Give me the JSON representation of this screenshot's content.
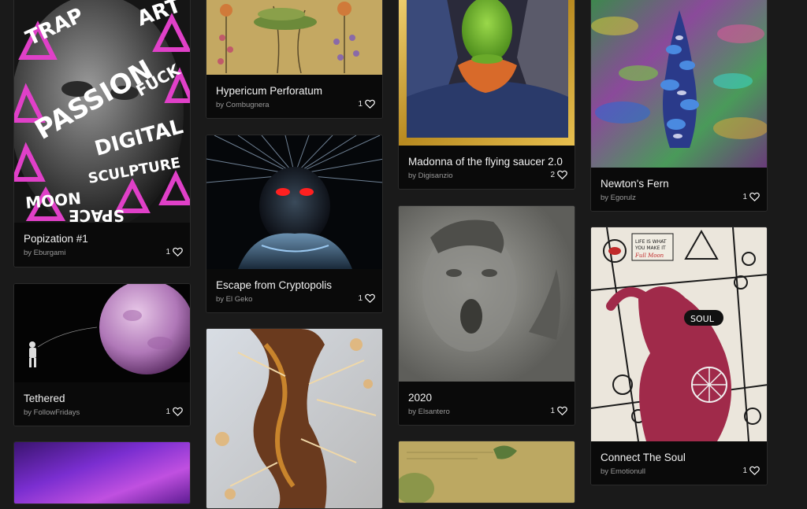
{
  "cards": [
    {
      "title": "Popization #1",
      "author": "by Eburgami",
      "likes": "1",
      "art_text": [
        "TRAP",
        "ART",
        "PASSION",
        "FUCK",
        "DIGITAL",
        "SCULPTURE",
        "MOON",
        "SPACE"
      ]
    },
    {
      "title": "Tethered",
      "author": "by FollowFridays",
      "likes": "1"
    },
    {
      "title": "Hypericum Perforatum",
      "author": "by Combugnera",
      "likes": "1"
    },
    {
      "title": "Escape from Cryptopolis",
      "author": "by El Geko",
      "likes": "1"
    },
    {
      "title": "Madonna of the flying saucer 2.0",
      "author": "by Digisanzio",
      "likes": "2"
    },
    {
      "title": "2020",
      "author": "by Elsantero",
      "likes": "1"
    },
    {
      "title": "Newton's Fern",
      "author": "by Egorulz",
      "likes": "1"
    },
    {
      "title": "Connect The Soul",
      "author": "by Emotionull",
      "likes": "1",
      "art_text": [
        "LIFE IS WHAT",
        "YOU MAKE IT",
        "Full Moon",
        "SOUL"
      ]
    }
  ],
  "colors": {
    "page_bg": "#1a1a1a",
    "card_bg": "#0a0a0a",
    "heart": "#ffffff"
  }
}
